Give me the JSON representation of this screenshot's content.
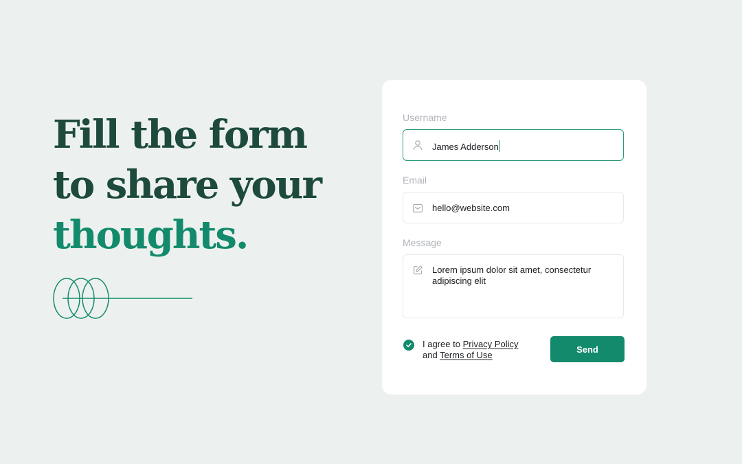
{
  "hero": {
    "line1": "Fill the form",
    "line2": "to share your",
    "line3": "thoughts."
  },
  "form": {
    "username": {
      "label": "Username",
      "value": "James Adderson",
      "icon": "user-icon"
    },
    "email": {
      "label": "Email",
      "value": "hello@website.com",
      "icon": "mail-icon"
    },
    "message": {
      "label": "Message",
      "value": "Lorem ipsum dolor sit amet, consectetur adipiscing elit",
      "icon": "edit-icon"
    },
    "agree": {
      "checked": true,
      "prefix": "I agree to",
      "privacy_link": "Privacy Policy",
      "and": "and",
      "terms_link": "Terms of Use"
    },
    "send_label": "Send"
  },
  "colors": {
    "background": "#ecf1ef",
    "heading": "#1d4a3d",
    "accent": "#128a6b",
    "focus_border": "#2c9a7c"
  }
}
